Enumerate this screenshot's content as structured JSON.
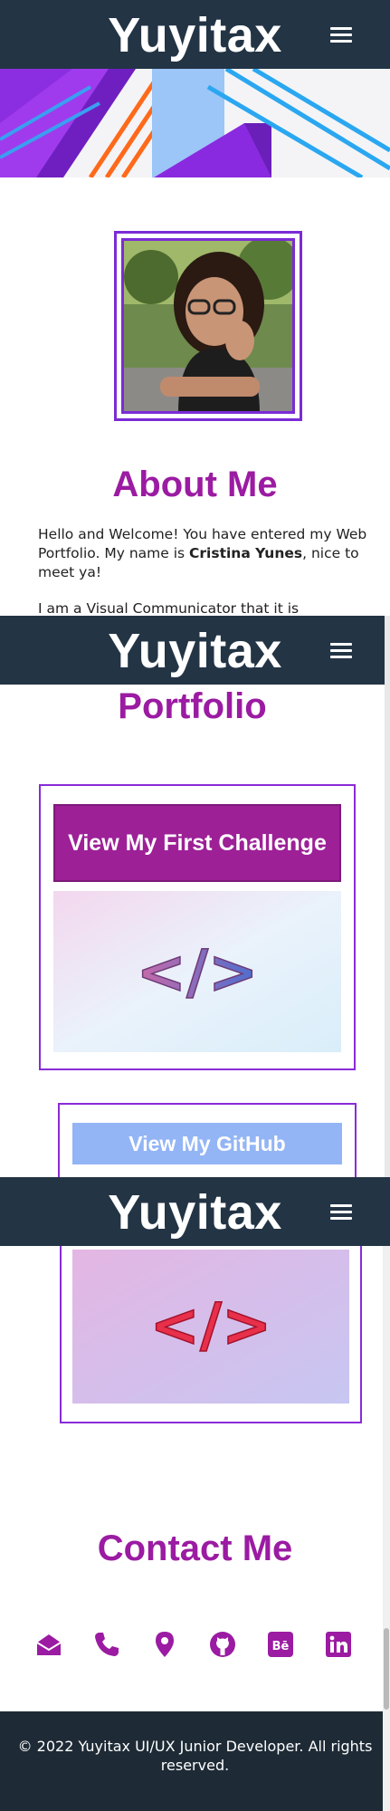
{
  "brand": "Yuyitax",
  "about": {
    "title": "About Me",
    "intro_before": "Hello and Welcome! You have entered my Web Portfolio. My name is ",
    "intro_name": "Cristina Yunes",
    "intro_after": ", nice to meet ya!",
    "paragraph2": "I am a Visual Communicator that it is passionate"
  },
  "portfolio": {
    "title": "Portfolio",
    "first_challenge_label": "View My First Challenge",
    "github_label": "View My GitHub"
  },
  "contact": {
    "title": "Contact Me",
    "icons": [
      "email-icon",
      "phone-icon",
      "location-icon",
      "github-icon",
      "behance-icon",
      "linkedin-icon"
    ]
  },
  "footer": {
    "text": "© 2022 Yuyitax UI/UX Junior Developer. All rights reserved."
  },
  "colors": {
    "navbar": "#233445",
    "accent": "#9b1ba2",
    "frame": "#7b2bd6",
    "github_button": "#93b5f5",
    "footer": "#1e2b36"
  }
}
